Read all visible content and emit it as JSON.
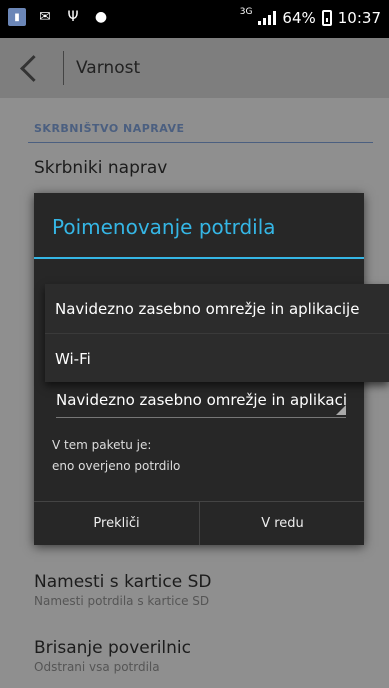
{
  "status_bar": {
    "network": "3G",
    "battery": "64%",
    "time": "10:37"
  },
  "app_bar": {
    "title": "Varnost"
  },
  "background": {
    "section_title": "SKRBNIŠTVO NAPRAVE",
    "item1": {
      "title": "Skrbniki naprav"
    },
    "item2": {
      "title": "Namesti s kartice SD",
      "subtitle": "Namesti potrdila s kartice SD"
    },
    "item3": {
      "title": "Brisanje poverilnic",
      "subtitle": "Odstrani vsa potrdila"
    }
  },
  "dialog": {
    "title": "Poimenovanje potrdila",
    "spinner_value": "Navidezno zasebno omrežje in aplikacije",
    "package_label": "V tem paketu je:",
    "package_content": "eno overjeno potrdilo",
    "cancel_label": "Prekliči",
    "ok_label": "V redu"
  },
  "dropdown": {
    "options": [
      "Navidezno zasebno omrežje in aplikacije",
      "Wi-Fi"
    ]
  },
  "colors": {
    "accent": "#35b6e5",
    "dialog_bg": "#272727",
    "scrim": "#8f8f8f"
  }
}
